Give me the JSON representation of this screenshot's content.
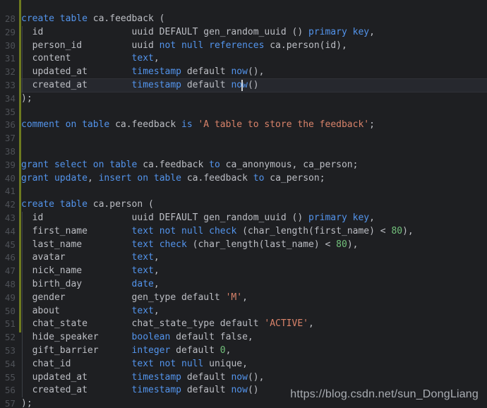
{
  "app": {
    "kind": "code-editor",
    "language": "SQL",
    "theme": "dark"
  },
  "colors": {
    "background": "#1e1f22",
    "current_line_background": "#26282e",
    "gutter_text": "#4e5157",
    "change_bar": "#6e7a1f",
    "keyword": "#5394ec",
    "identifier": "#bcbec4",
    "string": "#d9836a",
    "number": "#72c07b",
    "caret": "#cdd0d4",
    "watermark": "#a9adb3"
  },
  "gutter": {
    "first_visible_line": 28,
    "last_visible_line": 57,
    "line_numbers": [
      "28",
      "29",
      "30",
      "31",
      "32",
      "33",
      "34",
      "35",
      "36",
      "37",
      "38",
      "39",
      "40",
      "41",
      "42",
      "43",
      "44",
      "45",
      "46",
      "47",
      "48",
      "49",
      "50",
      "51",
      "52",
      "53",
      "54",
      "55",
      "56",
      "57"
    ],
    "change_bar_lines": [
      28,
      52
    ]
  },
  "editor": {
    "current_line_number": 33,
    "caret": {
      "line": 33,
      "column": 39
    },
    "char_width": 8.0,
    "line_height": 18.8
  },
  "watermark": {
    "text": "https://blog.csdn.net/sun_DongLiang"
  },
  "code_lines": [
    {
      "n": 28,
      "text": "create table ca.feedback (",
      "tokens": [
        {
          "t": "create",
          "c": "kw"
        },
        {
          "t": " ",
          "c": "punc"
        },
        {
          "t": "table",
          "c": "kw"
        },
        {
          "t": " ca.feedback (",
          "c": "id"
        }
      ]
    },
    {
      "n": 29,
      "text": "  id                uuid DEFAULT gen_random_uuid () primary key,",
      "tokens": [
        {
          "t": "  id                uuid DEFAULT gen_random_uuid () ",
          "c": "id"
        },
        {
          "t": "primary",
          "c": "kw"
        },
        {
          "t": " ",
          "c": "punc"
        },
        {
          "t": "key",
          "c": "kw"
        },
        {
          "t": ",",
          "c": "punc"
        }
      ]
    },
    {
      "n": 30,
      "text": "  person_id         uuid not null references ca.person(id),",
      "tokens": [
        {
          "t": "  person_id         uuid ",
          "c": "id"
        },
        {
          "t": "not",
          "c": "kw"
        },
        {
          "t": " ",
          "c": "punc"
        },
        {
          "t": "null",
          "c": "kw"
        },
        {
          "t": " ",
          "c": "punc"
        },
        {
          "t": "references",
          "c": "kw"
        },
        {
          "t": " ca.person(id),",
          "c": "id"
        }
      ]
    },
    {
      "n": 31,
      "text": "  content           text,",
      "tokens": [
        {
          "t": "  content           ",
          "c": "id"
        },
        {
          "t": "text",
          "c": "kw"
        },
        {
          "t": ",",
          "c": "punc"
        }
      ]
    },
    {
      "n": 32,
      "text": "  updated_at        timestamp default now(),",
      "tokens": [
        {
          "t": "  updated_at        ",
          "c": "id"
        },
        {
          "t": "timestamp",
          "c": "kw"
        },
        {
          "t": " default ",
          "c": "id"
        },
        {
          "t": "now",
          "c": "kw"
        },
        {
          "t": "(),",
          "c": "punc"
        }
      ]
    },
    {
      "n": 33,
      "text": "  created_at        timestamp default now()",
      "tokens": [
        {
          "t": "  created_at        ",
          "c": "id"
        },
        {
          "t": "timestamp",
          "c": "kw"
        },
        {
          "t": " default ",
          "c": "id"
        },
        {
          "t": "now",
          "c": "kw"
        },
        {
          "t": "()",
          "c": "punc"
        }
      ]
    },
    {
      "n": 34,
      "text": ");",
      "tokens": [
        {
          "t": ");",
          "c": "punc"
        }
      ]
    },
    {
      "n": 35,
      "text": "",
      "tokens": []
    },
    {
      "n": 36,
      "text": "comment on table ca.feedback is 'A table to store the feedback';",
      "tokens": [
        {
          "t": "comment",
          "c": "kw"
        },
        {
          "t": " ",
          "c": "punc"
        },
        {
          "t": "on",
          "c": "kw"
        },
        {
          "t": " ",
          "c": "punc"
        },
        {
          "t": "table",
          "c": "kw"
        },
        {
          "t": " ca.feedback ",
          "c": "id"
        },
        {
          "t": "is",
          "c": "kw"
        },
        {
          "t": " ",
          "c": "punc"
        },
        {
          "t": "'A table to store the feedback'",
          "c": "str"
        },
        {
          "t": ";",
          "c": "punc"
        }
      ]
    },
    {
      "n": 37,
      "text": "",
      "tokens": []
    },
    {
      "n": 38,
      "text": "",
      "tokens": []
    },
    {
      "n": 39,
      "text": "grant select on table ca.feedback to ca_anonymous, ca_person;",
      "tokens": [
        {
          "t": "grant",
          "c": "kw"
        },
        {
          "t": " ",
          "c": "punc"
        },
        {
          "t": "select",
          "c": "kw"
        },
        {
          "t": " ",
          "c": "punc"
        },
        {
          "t": "on",
          "c": "kw"
        },
        {
          "t": " ",
          "c": "punc"
        },
        {
          "t": "table",
          "c": "kw"
        },
        {
          "t": " ca.feedback ",
          "c": "id"
        },
        {
          "t": "to",
          "c": "kw"
        },
        {
          "t": " ca_anonymous, ca_person;",
          "c": "id"
        }
      ]
    },
    {
      "n": 40,
      "text": "grant update, insert on table ca.feedback to ca_person;",
      "tokens": [
        {
          "t": "grant",
          "c": "kw"
        },
        {
          "t": " ",
          "c": "punc"
        },
        {
          "t": "update",
          "c": "kw"
        },
        {
          "t": ", ",
          "c": "punc"
        },
        {
          "t": "insert",
          "c": "kw"
        },
        {
          "t": " ",
          "c": "punc"
        },
        {
          "t": "on",
          "c": "kw"
        },
        {
          "t": " ",
          "c": "punc"
        },
        {
          "t": "table",
          "c": "kw"
        },
        {
          "t": " ca.feedback ",
          "c": "id"
        },
        {
          "t": "to",
          "c": "kw"
        },
        {
          "t": " ca_person;",
          "c": "id"
        }
      ]
    },
    {
      "n": 41,
      "text": "",
      "tokens": []
    },
    {
      "n": 42,
      "text": "create table ca.person (",
      "tokens": [
        {
          "t": "create",
          "c": "kw"
        },
        {
          "t": " ",
          "c": "punc"
        },
        {
          "t": "table",
          "c": "kw"
        },
        {
          "t": " ca.person (",
          "c": "id"
        }
      ]
    },
    {
      "n": 43,
      "text": "  id                uuid DEFAULT gen_random_uuid () primary key,",
      "tokens": [
        {
          "t": "  id                uuid DEFAULT gen_random_uuid () ",
          "c": "id"
        },
        {
          "t": "primary",
          "c": "kw"
        },
        {
          "t": " ",
          "c": "punc"
        },
        {
          "t": "key",
          "c": "kw"
        },
        {
          "t": ",",
          "c": "punc"
        }
      ]
    },
    {
      "n": 44,
      "text": "  first_name        text not null check (char_length(first_name) < 80),",
      "tokens": [
        {
          "t": "  first_name        ",
          "c": "id"
        },
        {
          "t": "text",
          "c": "kw"
        },
        {
          "t": " ",
          "c": "punc"
        },
        {
          "t": "not",
          "c": "kw"
        },
        {
          "t": " ",
          "c": "punc"
        },
        {
          "t": "null",
          "c": "kw"
        },
        {
          "t": " ",
          "c": "punc"
        },
        {
          "t": "check",
          "c": "kw"
        },
        {
          "t": " (char_length(first_name) < ",
          "c": "id"
        },
        {
          "t": "80",
          "c": "num"
        },
        {
          "t": "),",
          "c": "punc"
        }
      ]
    },
    {
      "n": 45,
      "text": "  last_name         text check (char_length(last_name) < 80),",
      "tokens": [
        {
          "t": "  last_name         ",
          "c": "id"
        },
        {
          "t": "text",
          "c": "kw"
        },
        {
          "t": " ",
          "c": "punc"
        },
        {
          "t": "check",
          "c": "kw"
        },
        {
          "t": " (char_length(last_name) < ",
          "c": "id"
        },
        {
          "t": "80",
          "c": "num"
        },
        {
          "t": "),",
          "c": "punc"
        }
      ]
    },
    {
      "n": 46,
      "text": "  avatar            text,",
      "tokens": [
        {
          "t": "  avatar            ",
          "c": "id"
        },
        {
          "t": "text",
          "c": "kw"
        },
        {
          "t": ",",
          "c": "punc"
        }
      ]
    },
    {
      "n": 47,
      "text": "  nick_name         text,",
      "tokens": [
        {
          "t": "  nick_name         ",
          "c": "id"
        },
        {
          "t": "text",
          "c": "kw"
        },
        {
          "t": ",",
          "c": "punc"
        }
      ]
    },
    {
      "n": 48,
      "text": "  birth_day         date,",
      "tokens": [
        {
          "t": "  birth_day         ",
          "c": "id"
        },
        {
          "t": "date",
          "c": "kw"
        },
        {
          "t": ",",
          "c": "punc"
        }
      ]
    },
    {
      "n": 49,
      "text": "  gender            gen_type default 'M',",
      "tokens": [
        {
          "t": "  gender            gen_type default ",
          "c": "id"
        },
        {
          "t": "'M'",
          "c": "str"
        },
        {
          "t": ",",
          "c": "punc"
        }
      ]
    },
    {
      "n": 50,
      "text": "  about             text,",
      "tokens": [
        {
          "t": "  about             ",
          "c": "id"
        },
        {
          "t": "text",
          "c": "kw"
        },
        {
          "t": ",",
          "c": "punc"
        }
      ]
    },
    {
      "n": 51,
      "text": "  chat_state        chat_state_type default 'ACTIVE',",
      "tokens": [
        {
          "t": "  chat_state        chat_state_type default ",
          "c": "id"
        },
        {
          "t": "'ACTIVE'",
          "c": "str"
        },
        {
          "t": ",",
          "c": "punc"
        }
      ]
    },
    {
      "n": 52,
      "text": "  hide_speaker      boolean default false,",
      "tokens": [
        {
          "t": "  hide_speaker      ",
          "c": "id"
        },
        {
          "t": "boolean",
          "c": "kw"
        },
        {
          "t": " default false,",
          "c": "id"
        }
      ]
    },
    {
      "n": 53,
      "text": "  gift_barrier      integer default 0,",
      "tokens": [
        {
          "t": "  gift_barrier      ",
          "c": "id"
        },
        {
          "t": "integer",
          "c": "kw"
        },
        {
          "t": " default ",
          "c": "id"
        },
        {
          "t": "0",
          "c": "num"
        },
        {
          "t": ",",
          "c": "punc"
        }
      ]
    },
    {
      "n": 54,
      "text": "  chat_id           text not null unique,",
      "tokens": [
        {
          "t": "  chat_id           ",
          "c": "id"
        },
        {
          "t": "text",
          "c": "kw"
        },
        {
          "t": " ",
          "c": "punc"
        },
        {
          "t": "not",
          "c": "kw"
        },
        {
          "t": " ",
          "c": "punc"
        },
        {
          "t": "null",
          "c": "kw"
        },
        {
          "t": " unique,",
          "c": "id"
        }
      ]
    },
    {
      "n": 55,
      "text": "  updated_at        timestamp default now(),",
      "tokens": [
        {
          "t": "  updated_at        ",
          "c": "id"
        },
        {
          "t": "timestamp",
          "c": "kw"
        },
        {
          "t": " default ",
          "c": "id"
        },
        {
          "t": "now",
          "c": "kw"
        },
        {
          "t": "(),",
          "c": "punc"
        }
      ]
    },
    {
      "n": 56,
      "text": "  created_at        timestamp default now()",
      "tokens": [
        {
          "t": "  created_at        ",
          "c": "id"
        },
        {
          "t": "timestamp",
          "c": "kw"
        },
        {
          "t": " default ",
          "c": "id"
        },
        {
          "t": "now",
          "c": "kw"
        },
        {
          "t": "()",
          "c": "punc"
        }
      ]
    },
    {
      "n": 57,
      "text": ");",
      "tokens": [
        {
          "t": ");",
          "c": "punc"
        }
      ]
    }
  ],
  "indent_guides": [
    {
      "from_line": 29,
      "to_line": 33,
      "column": 0
    },
    {
      "from_line": 43,
      "to_line": 56,
      "column": 0
    }
  ]
}
